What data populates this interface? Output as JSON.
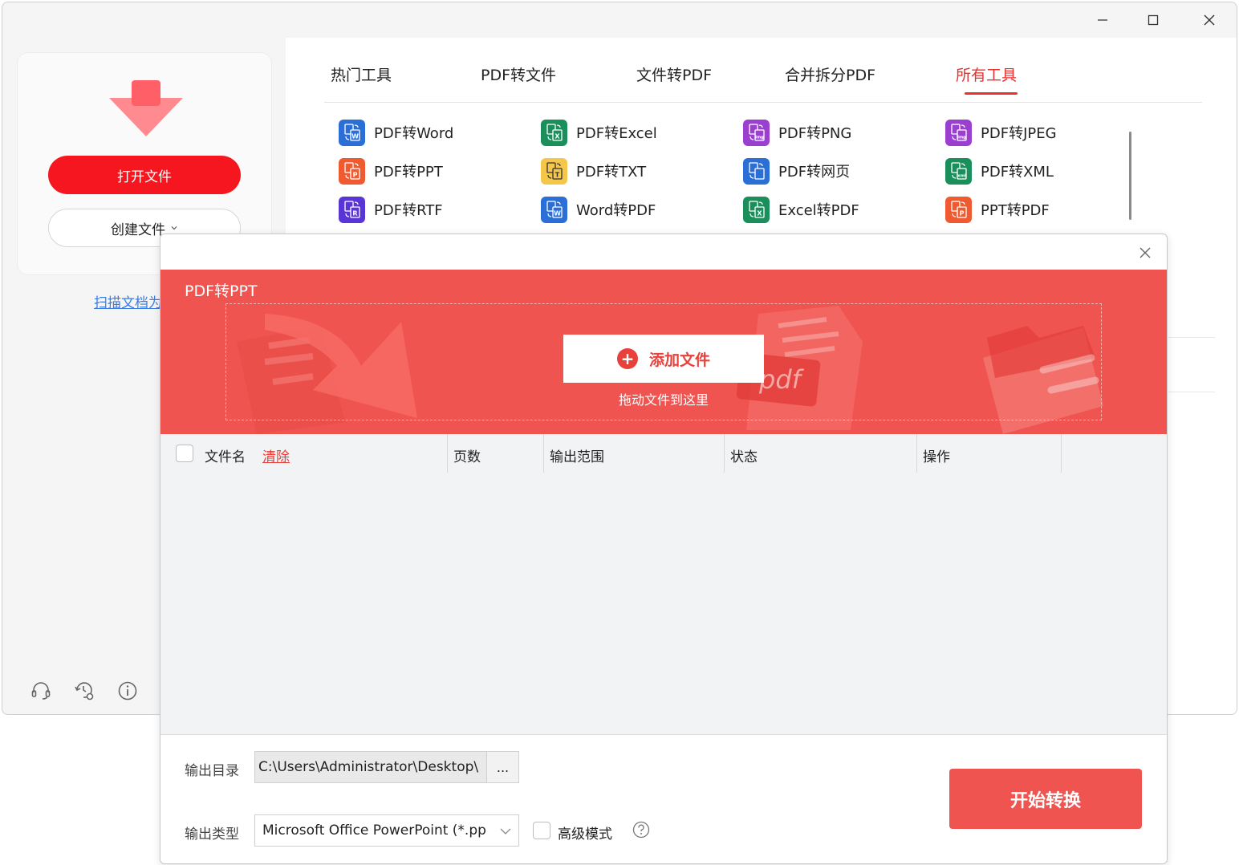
{
  "sidebar": {
    "open_file": "打开文件",
    "create_file": "创建文件",
    "scan_link": "扫描文档为"
  },
  "tabs": [
    {
      "label": "热门工具",
      "active": false
    },
    {
      "label": "PDF转文件",
      "active": false
    },
    {
      "label": "文件转PDF",
      "active": false
    },
    {
      "label": "合并拆分PDF",
      "active": false
    },
    {
      "label": "所有工具",
      "active": true
    }
  ],
  "tools": [
    {
      "label": "PDF转Word",
      "color": "#2b6fd6",
      "glyph": "W"
    },
    {
      "label": "PDF转Excel",
      "color": "#1a8f5c",
      "glyph": "X"
    },
    {
      "label": "PDF转PNG",
      "color": "#9b3fd0",
      "glyph": "img"
    },
    {
      "label": "PDF转JPEG",
      "color": "#9b3fd0",
      "glyph": "img"
    },
    {
      "label": "PDF转PPT",
      "color": "#ef5a30",
      "glyph": "P"
    },
    {
      "label": "PDF转TXT",
      "color": "#f4c64a",
      "glyph": "T"
    },
    {
      "label": "PDF转网页",
      "color": "#2b6fd6",
      "glyph": "</>"
    },
    {
      "label": "PDF转XML",
      "color": "#1a8f5c",
      "glyph": "xml"
    },
    {
      "label": "PDF转RTF",
      "color": "#5a35d6",
      "glyph": "R"
    },
    {
      "label": "Word转PDF",
      "color": "#2b6fd6",
      "glyph": "W"
    },
    {
      "label": "Excel转PDF",
      "color": "#1a8f5c",
      "glyph": "X"
    },
    {
      "label": "PPT转PDF",
      "color": "#ef5a30",
      "glyph": "P"
    }
  ],
  "dialog": {
    "title": "PDF转PPT",
    "add_file": "添加文件",
    "drag_hint": "拖动文件到这里",
    "columns": {
      "filename": "文件名",
      "clear": "清除",
      "pages": "页数",
      "range": "输出范围",
      "status": "状态",
      "action": "操作"
    },
    "output_dir_label": "输出目录",
    "output_dir_value": "C:\\Users\\Administrator\\Desktop\\",
    "browse": "...",
    "output_type_label": "输出类型",
    "output_type_value": "Microsoft Office PowerPoint (*.pp",
    "advanced_mode": "高级模式",
    "start": "开始转换"
  }
}
